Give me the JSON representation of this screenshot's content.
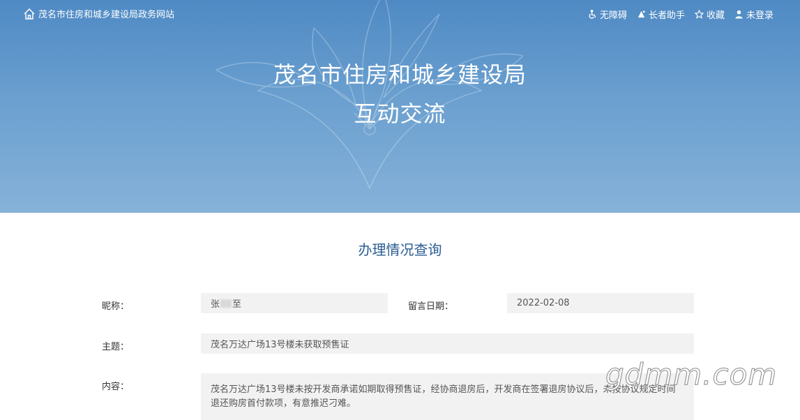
{
  "header": {
    "site_name": "茂名市住房和城乡建设局政务网站",
    "actions": [
      {
        "label": "无障碍",
        "icon": "accessibility-icon"
      },
      {
        "label": "长者助手",
        "icon": "elder-helper-icon"
      },
      {
        "label": "收藏",
        "icon": "star-icon"
      },
      {
        "label": "未登录",
        "icon": "user-icon"
      }
    ]
  },
  "banner": {
    "title": "茂名市住房和城乡建设局",
    "subtitle": "互动交流"
  },
  "section": {
    "title": "办理情况查询"
  },
  "form": {
    "nickname_label": "昵称：",
    "nickname_first": "张",
    "nickname_last": "至",
    "date_label": "留言日期：",
    "date_value": "2022-02-08",
    "subject_label": "主题：",
    "subject_value": "茂名万达广场13号楼未获取预售证",
    "content_label": "内容：",
    "content_value": "茂名万达广场13号楼未按开发商承诺如期取得预售证，经协商退房后，开发商在签署退房协议后，未按协议规定时间退还购房首付款项，有意推迟刁难。"
  },
  "watermark": "gdmm.com",
  "colors": {
    "banner": "#5b93c9",
    "section_title": "#2b5d94",
    "field_bg": "#f2f2f2"
  }
}
